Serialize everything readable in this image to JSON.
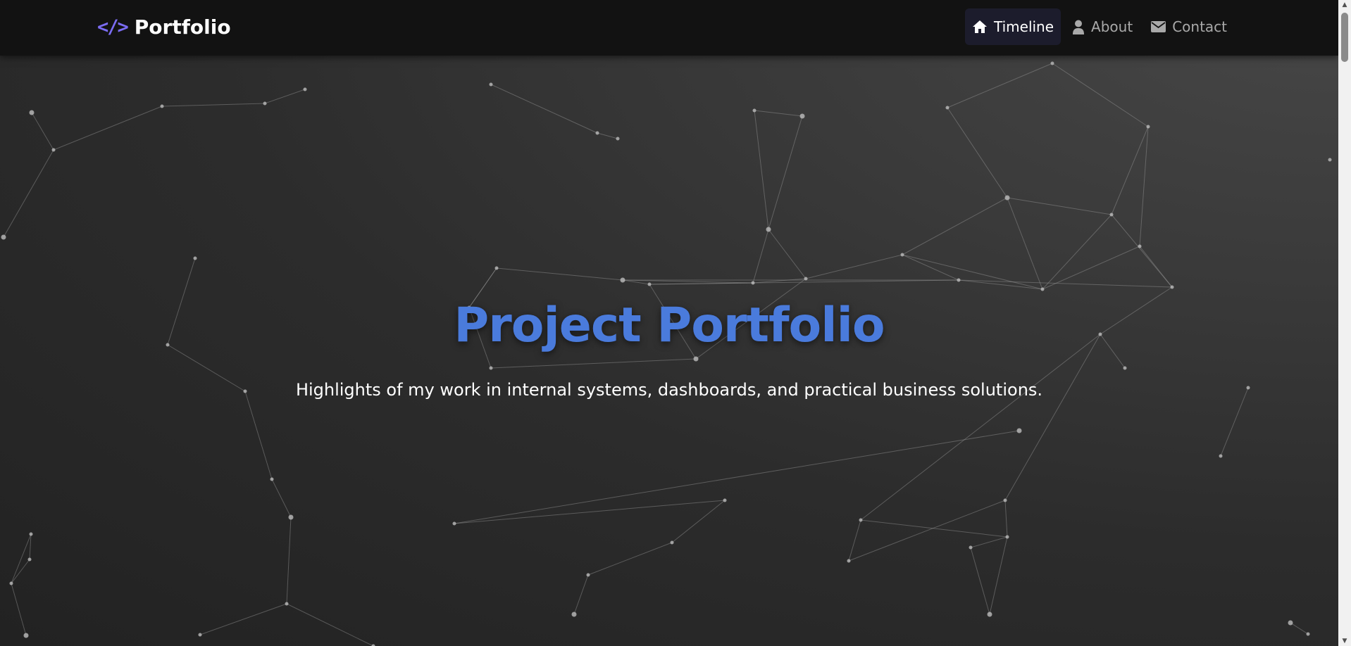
{
  "brand": {
    "icon": "code-icon",
    "icon_glyph": "</>",
    "name": "Portfolio",
    "accent_color": "#7b6cf2"
  },
  "nav": {
    "items": [
      {
        "label": "Timeline",
        "icon": "home-icon",
        "active": true
      },
      {
        "label": "About",
        "icon": "user-icon",
        "active": false
      },
      {
        "label": "Contact",
        "icon": "envelope-icon",
        "active": false
      }
    ]
  },
  "hero": {
    "title": "Project Portfolio",
    "subtitle": "Highlights of my work in internal systems, dashboards, and practical business solutions.",
    "title_color": "#4a7bdc"
  },
  "background": {
    "type": "particle-network",
    "line_color": "#9a9a9a",
    "node_color": "#bdbdbd"
  },
  "scrollbar": {
    "up_glyph": "▲",
    "down_glyph": "▼"
  }
}
